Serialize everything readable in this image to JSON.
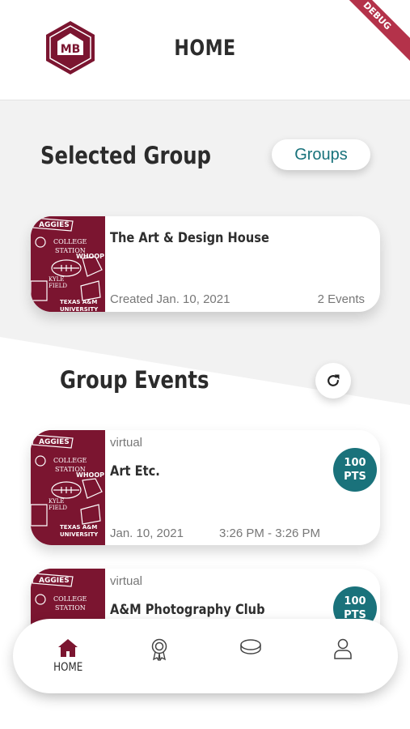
{
  "header": {
    "title": "HOME",
    "logo_text": "MB",
    "debug_label": "DEBUG"
  },
  "selected_group": {
    "section_title": "Selected Group",
    "groups_button": "Groups",
    "card": {
      "name": "The Art & Design House",
      "created": "Created Jan. 10, 2021",
      "event_count": "2 Events"
    }
  },
  "group_events": {
    "section_title": "Group Events",
    "events": [
      {
        "type": "virtual",
        "name": "Art Etc.",
        "points": "100",
        "points_unit": "PTS",
        "date": "Jan. 10, 2021",
        "time": "3:26 PM - 3:26 PM"
      },
      {
        "type": "virtual",
        "name": "A&M Photography Club",
        "points": "100",
        "points_unit": "PTS"
      }
    ]
  },
  "thumbnail_text": [
    "AGGIES",
    "COLLEGE",
    "STATION",
    "WHOOP!",
    "KYLE",
    "FIELD",
    "TEXAS A&M",
    "UNIVERSITY"
  ],
  "bottom_nav": {
    "items": [
      {
        "label": "HOME",
        "icon": "home-icon",
        "active": true
      },
      {
        "icon": "award-icon"
      },
      {
        "icon": "coin-icon"
      },
      {
        "icon": "user-icon"
      }
    ]
  },
  "colors": {
    "maroon": "#7b1530",
    "teal": "#1a727b",
    "debug": "#b4324a"
  }
}
